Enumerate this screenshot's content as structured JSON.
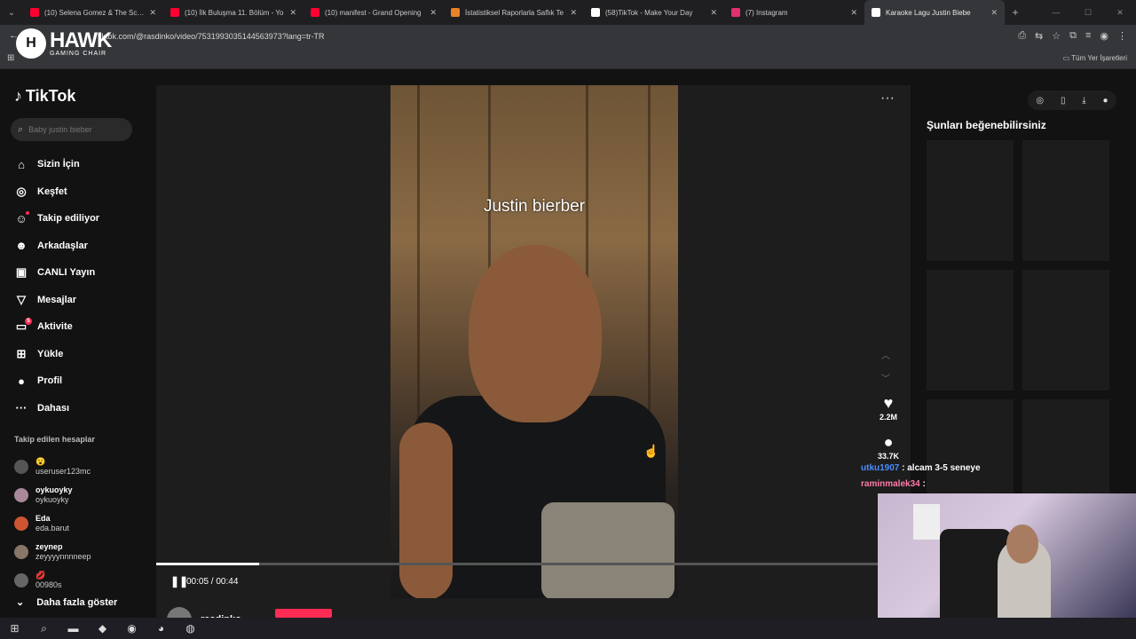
{
  "browser": {
    "tabs": [
      {
        "title": "(10) Selena Gomez & The Scene",
        "icon": "youtube-icon",
        "color": "#ff0033"
      },
      {
        "title": "(10) İlk Buluşma 11. Bölüm - Yo",
        "icon": "youtube-icon",
        "color": "#ff0033"
      },
      {
        "title": "(10) manifest - Grand Opening",
        "icon": "youtube-icon",
        "color": "#ff0033"
      },
      {
        "title": "İstatistiksel Raporlarla Saflık Te",
        "icon": "fox-icon",
        "color": "#e8832a"
      },
      {
        "title": "(58)TikTok - Make Your Day",
        "icon": "tiktok-icon",
        "color": "#ffffff"
      },
      {
        "title": "(7) Instagram",
        "icon": "instagram-icon",
        "color": "#e1306c"
      },
      {
        "title": "Karaoke Lagu Justin Biebe",
        "icon": "tiktok-icon",
        "color": "#ffffff"
      }
    ],
    "url": "tiktok.com/@rasdinko/video/7531993035144563973?lang=tr-TR",
    "bookmarks_all": "Tüm Yer İşaretleri"
  },
  "overlay": {
    "brand": "HAWK",
    "brand_sub": "GAMING CHAIR"
  },
  "sidebar": {
    "logo": "TikTok",
    "search_placeholder": "Baby justin bieber",
    "nav": [
      {
        "label": "Sizin İçin",
        "icon": "home-icon",
        "glyph": "⌂"
      },
      {
        "label": "Keşfet",
        "icon": "compass-icon",
        "glyph": "◎"
      },
      {
        "label": "Takip ediliyor",
        "icon": "following-icon",
        "glyph": "☺"
      },
      {
        "label": "Arkadaşlar",
        "icon": "friends-icon",
        "glyph": "☻"
      },
      {
        "label": "CANLI Yayın",
        "icon": "live-icon",
        "glyph": "▣"
      },
      {
        "label": "Mesajlar",
        "icon": "messages-icon",
        "glyph": "▽"
      },
      {
        "label": "Aktivite",
        "icon": "activity-icon",
        "glyph": "▭",
        "badge": "5"
      },
      {
        "label": "Yükle",
        "icon": "upload-icon",
        "glyph": "⊞"
      },
      {
        "label": "Profil",
        "icon": "profile-icon",
        "glyph": "●"
      },
      {
        "label": "Dahası",
        "icon": "more-icon",
        "glyph": "···"
      }
    ],
    "following_title": "Takip edilen hesaplar",
    "following": [
      {
        "name": "😮",
        "handle": "useruser123mc"
      },
      {
        "name": "oykuoyky",
        "handle": "oykuoyky"
      },
      {
        "name": "Eda",
        "handle": "eda.barut"
      },
      {
        "name": "zeynep",
        "handle": "zeyyyynnnneep"
      },
      {
        "name": "💋",
        "handle": "00980s"
      }
    ],
    "show_more": "Daha fazla göster"
  },
  "video": {
    "caption": "Justin bierber",
    "likes": "2.2M",
    "comments": "33.7K",
    "time": "00:05 / 00:44",
    "progress": 0.137,
    "author": "rasdinko"
  },
  "right_panel": {
    "title": "Şunları beğenebilirsiniz"
  },
  "chat": [
    {
      "user": "utku1907",
      "message": ": alcam 3-5 seneye"
    },
    {
      "user": "raminmalek34",
      "message": ":"
    }
  ]
}
